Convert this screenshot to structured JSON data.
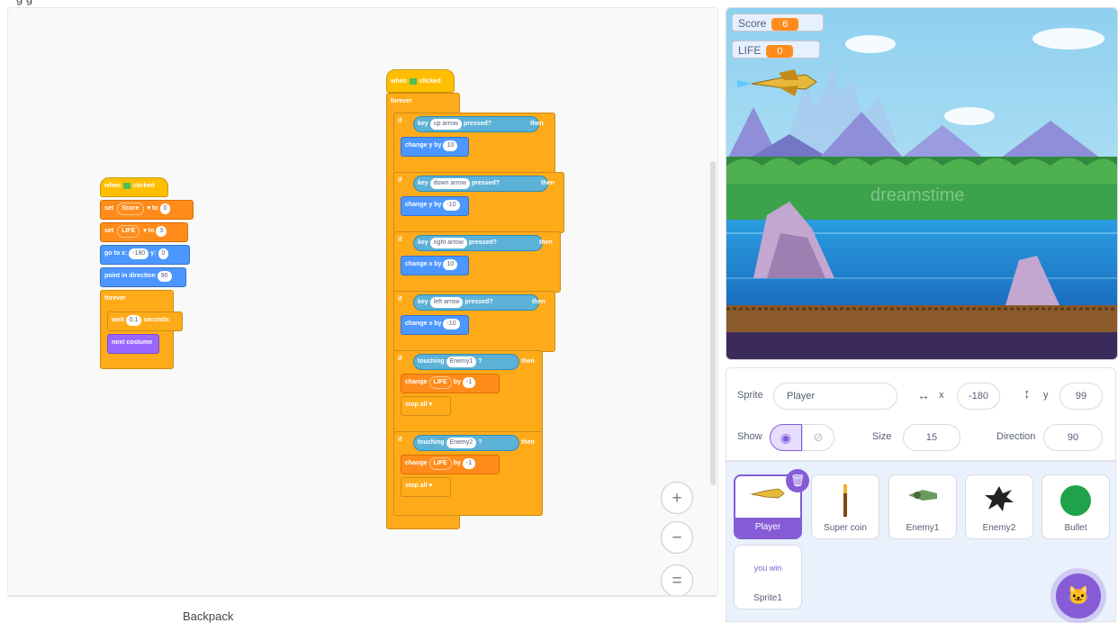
{
  "page": {
    "top_text": "g g",
    "backpack_label": "Backpack"
  },
  "zoom": {
    "zoom_in": "+",
    "zoom_out": "−",
    "reset": "="
  },
  "script1": {
    "hat_when": "when",
    "hat_clicked": "clicked",
    "set1_label": "set",
    "set1_var": "Score",
    "set1_to": "to",
    "set1_val": "0",
    "set2_label": "set",
    "set2_var": "LIFE",
    "set2_to": "to",
    "set2_val": "3",
    "goto_label": "go to x:",
    "goto_x": "-180",
    "goto_y_label": "y:",
    "goto_y": "0",
    "point_label": "point in direction",
    "point_val": "90",
    "forever": "forever",
    "wait_label": "wait",
    "wait_val": "0.1",
    "wait_unit": "seconds",
    "next_costume": "next costume"
  },
  "script2": {
    "hat_when": "when",
    "hat_clicked": "clicked",
    "forever": "forever",
    "if_label": "if",
    "then_label": "then",
    "key_label": "key",
    "pressed_label": "pressed?",
    "key1": "up arrow",
    "key2": "down arrow",
    "key3": "right arrow",
    "key4": "left arrow",
    "change_y": "change y by",
    "change_x": "change x by",
    "cy1": "10",
    "cy2": "-10",
    "cx1": "10",
    "cx2": "-10",
    "touching_label": "touching",
    "q": "?",
    "enemy1": "Enemy1",
    "enemy2": "Enemy2",
    "change_label": "change",
    "change_var": "LIFE",
    "by_label": "by",
    "change_val": "-1",
    "stop_label": "stop",
    "stop_val": "all"
  },
  "stage": {
    "score_label": "Score",
    "score_value": "6",
    "life_label": "LIFE",
    "life_value": "0",
    "watermark": "dreamstime"
  },
  "sprite_info": {
    "sprite_label": "Sprite",
    "sprite_name": "Player",
    "x_label": "x",
    "x_value": "-180",
    "y_label": "y",
    "y_value": "99",
    "show_label": "Show",
    "size_label": "Size",
    "size_value": "15",
    "direction_label": "Direction",
    "direction_value": "90"
  },
  "sprites": {
    "items": [
      {
        "name": "Player",
        "thumb": "jet-icon"
      },
      {
        "name": "Super coin",
        "thumb": "coin-stick-icon"
      },
      {
        "name": "Enemy1",
        "thumb": "enemy-plane-icon"
      },
      {
        "name": "Enemy2",
        "thumb": "spiky-creature-icon"
      },
      {
        "name": "Bullet",
        "thumb": "green-circle-icon"
      },
      {
        "name": "Sprite1",
        "thumb_text": "you win"
      }
    ]
  },
  "colors": {
    "accent": "#855cd6",
    "events": "#ffbf00",
    "control": "#ffab19",
    "variables": "#ff8c1a",
    "motion": "#4c97ff",
    "looks": "#9966ff",
    "sensing": "#5cb1d6"
  }
}
